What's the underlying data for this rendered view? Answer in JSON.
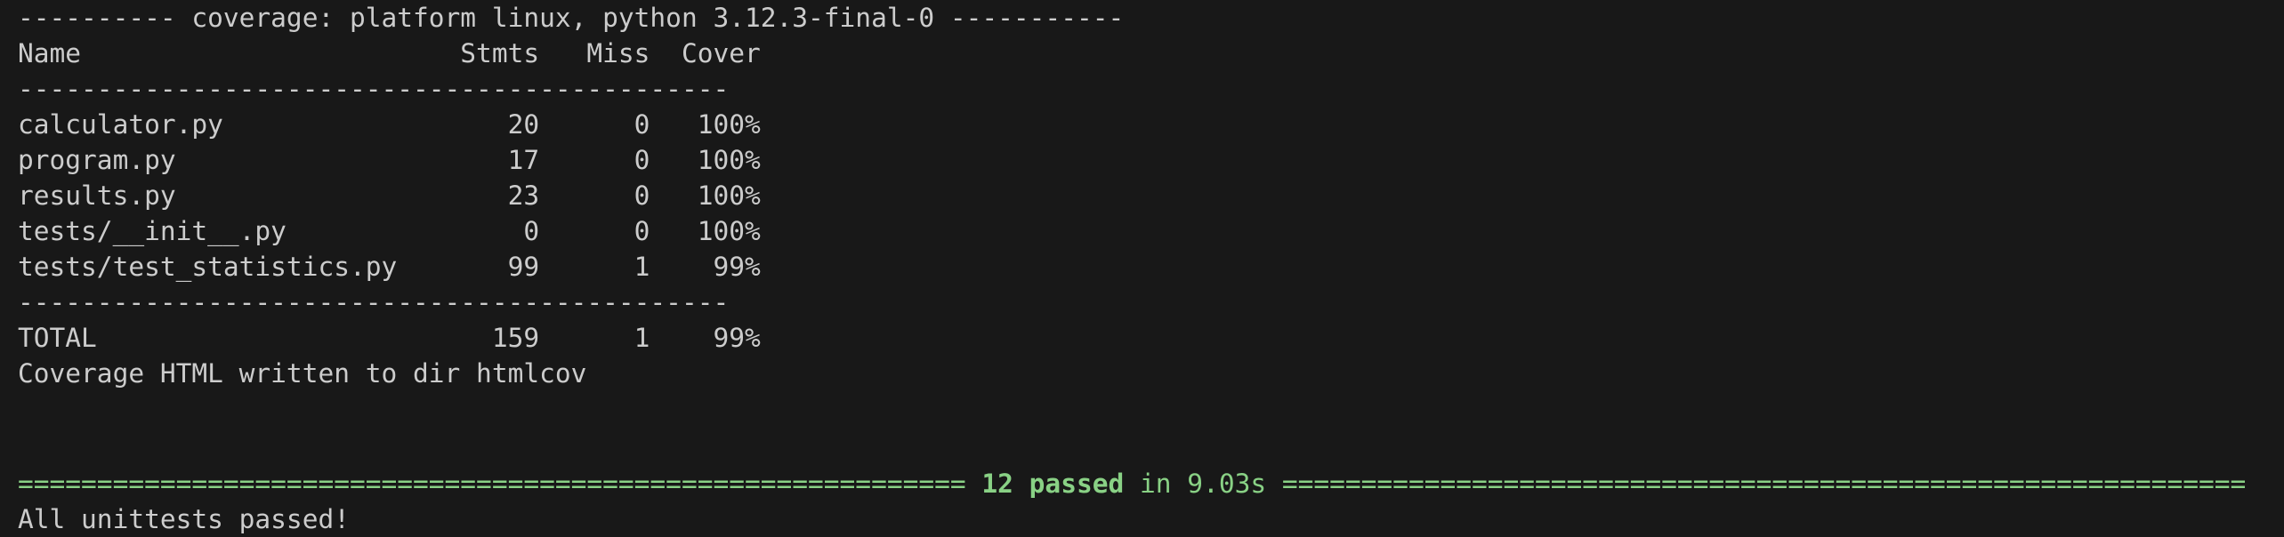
{
  "terminal": {
    "coverage_header": "---------- coverage: platform linux, python 3.12.3-final-0 -----------",
    "table_header": "Name                        Stmts   Miss  Cover",
    "separator": "---------------------------------------------",
    "rows": [
      "calculator.py                  20      0   100%",
      "program.py                     17      0   100%",
      "results.py                     23      0   100%",
      "tests/__init__.py               0      0   100%",
      "tests/test_statistics.py       99      1    99%"
    ],
    "total_row": "TOTAL                         159      1    99%",
    "html_written": "Coverage HTML written to dir htmlcov",
    "summary": {
      "left_rule": "============================================================ ",
      "passed": "12 passed",
      "time": " in 9.03s ",
      "right_rule": "============================================================="
    },
    "final_message": "All unittests passed!"
  },
  "colors": {
    "background": "#181818",
    "text": "#cccccc",
    "success_green": "#89d185"
  }
}
